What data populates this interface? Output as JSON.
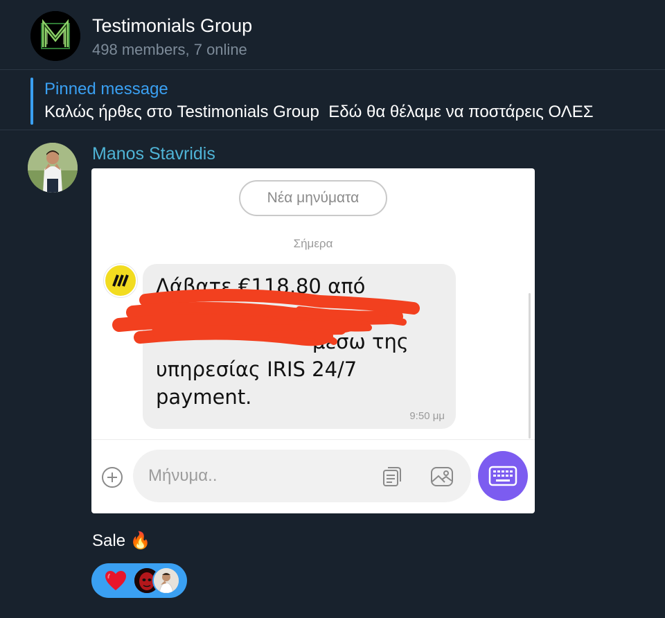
{
  "header": {
    "title": "Testimonials Group",
    "subtitle": "498 members, 7 online",
    "avatar_letter": "M"
  },
  "pinned": {
    "title": "Pinned message",
    "text": "Καλώς ήρθες στο Testimonials Group  Εδώ θα θέλαμε να ποστάρεις ΟΛΕΣ"
  },
  "message": {
    "sender": "Manos Stavridis",
    "caption": "Sale 🔥",
    "reactions": {
      "emoji": "heart",
      "count_avatars": 2
    }
  },
  "screenshot": {
    "new_messages_label": "Νέα μηνύματα",
    "date_label": "Σήμερα",
    "bank_logo_text": "///",
    "sms": {
      "line1": "Λάβατε €118,80 από",
      "line2": "μεσω της",
      "line3": "υπηρεσίας IRIS 24/7",
      "line4": "payment.",
      "time": "9:50 μμ"
    },
    "input_placeholder": "Μήνυμα.."
  },
  "colors": {
    "background": "#18222d",
    "accent": "#3aa0f2",
    "sender": "#4fb4d6",
    "redaction": "#f2401f",
    "keyboard_button": "#7c5cf0"
  }
}
